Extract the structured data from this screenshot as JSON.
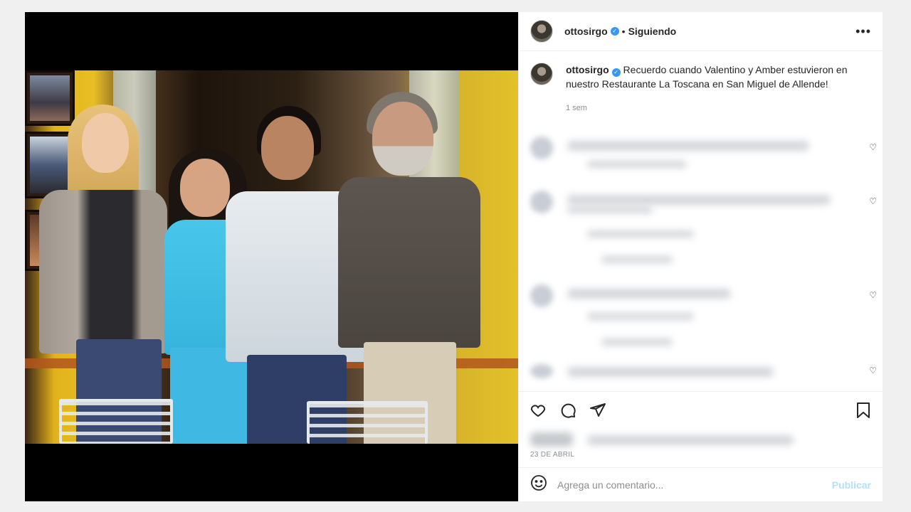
{
  "header": {
    "username": "ottosirgo",
    "separator": "•",
    "follow_label": "Siguiendo",
    "more_label": "•••"
  },
  "caption": {
    "username": "ottosirgo",
    "text": "Recuerdo cuando Valentino y Amber estuvieron en nuestro Restaurante La Toscana en San Miguel de Allende!",
    "time": "1 sem"
  },
  "post": {
    "date": "23 DE ABRIL"
  },
  "comment_box": {
    "placeholder": "Agrega un comentario...",
    "publish_label": "Publicar"
  },
  "colors": {
    "verified": "#3897f0",
    "publish_disabled": "#b2dffc"
  },
  "icons": [
    "heart-icon",
    "comment-icon",
    "share-icon",
    "bookmark-icon",
    "emoji-icon",
    "more-icon",
    "verified-icon"
  ]
}
